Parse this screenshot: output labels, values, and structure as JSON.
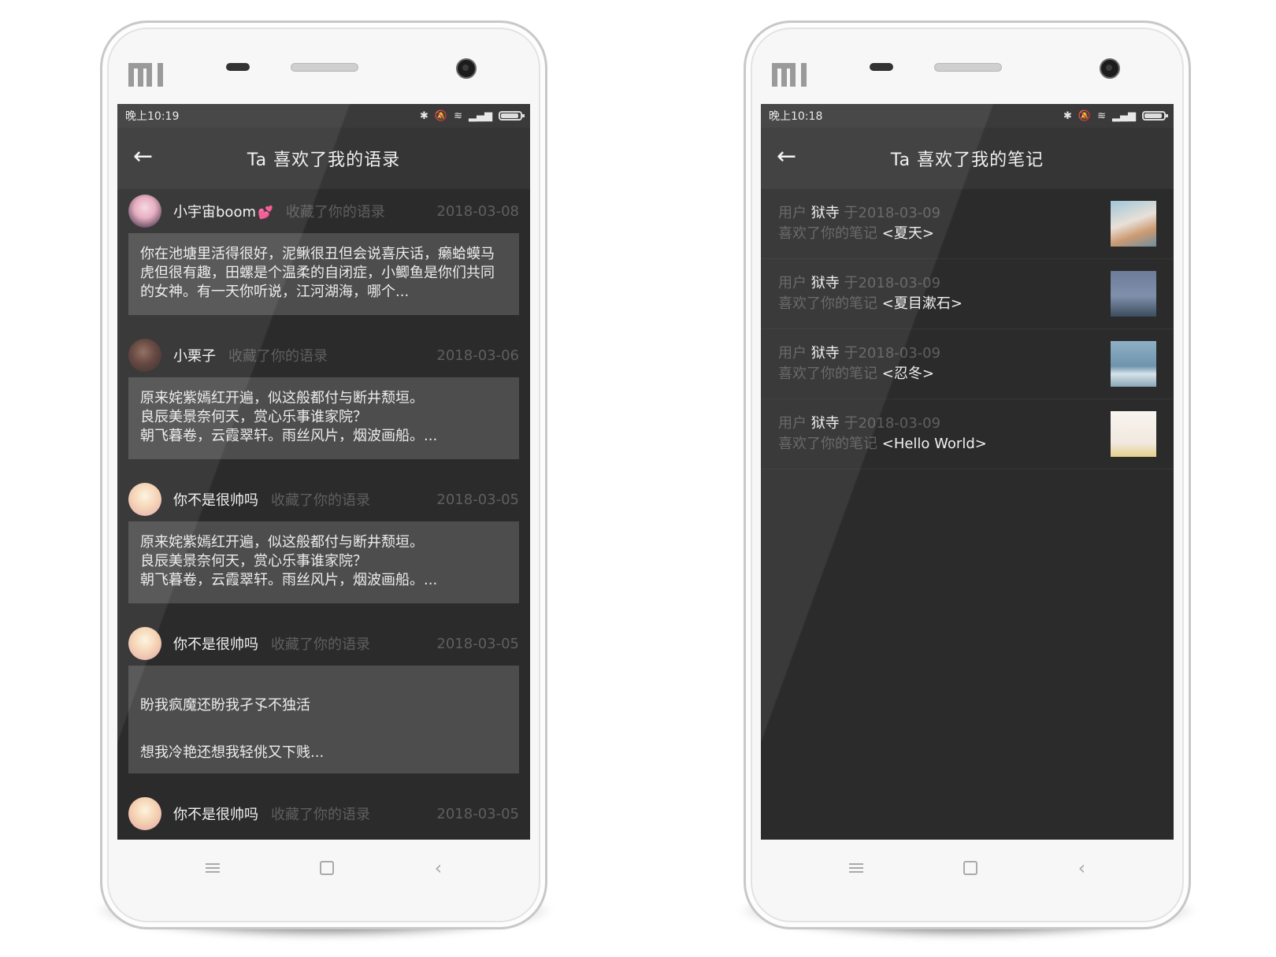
{
  "left_phone": {
    "brand": "mi",
    "status_time": "晚上10:19",
    "status_icons": [
      "bluetooth-icon",
      "mute-icon",
      "wifi-icon",
      "signal-icon",
      "battery-icon"
    ],
    "title": "Ta 喜欢了我的语录",
    "entries": [
      {
        "user": "小宇宙boom",
        "user_suffix": "💕",
        "action": "收藏了你的语录",
        "date": "2018-03-08",
        "quote": "你在池塘里活得很好，泥鳅很丑但会说喜庆话，癞蛤蟆马虎但很有趣，田螺是个温柔的自闭症，小鲫鱼是你们共同的女神。有一天你听说，江河湖海，哪个..."
      },
      {
        "user": "小栗子",
        "user_suffix": "",
        "action": "收藏了你的语录",
        "date": "2018-03-06",
        "quote": "原来姹紫嫣红开遍，似这般都付与断井颓垣。\n良辰美景奈何天，赏心乐事谁家院？\n朝飞暮卷，云霞翠轩。雨丝风片，烟波画船。..."
      },
      {
        "user": "你不是很帅吗",
        "user_suffix": "",
        "action": "收藏了你的语录",
        "date": "2018-03-05",
        "quote": "原来姹紫嫣红开遍，似这般都付与断井颓垣。\n良辰美景奈何天，赏心乐事谁家院？\n朝飞暮卷，云霞翠轩。雨丝风片，烟波画船。..."
      },
      {
        "user": "你不是很帅吗",
        "user_suffix": "",
        "action": "收藏了你的语录",
        "date": "2018-03-05",
        "quote_line1": "盼我疯魔还盼我孑孓不独活",
        "quote_line2": "想我冷艳还想我轻佻又下贱..."
      },
      {
        "user": "你不是很帅吗",
        "user_suffix": "",
        "action": "收藏了你的语录",
        "date": "2018-03-05"
      }
    ]
  },
  "right_phone": {
    "brand": "mi",
    "status_time": "晚上10:18",
    "status_icons": [
      "bluetooth-icon",
      "mute-icon",
      "wifi-icon",
      "signal-icon",
      "battery-icon"
    ],
    "title": "Ta 喜欢了我的笔记",
    "notes": [
      {
        "prefix": "用户",
        "user": "狱寺",
        "date_text": "于2018-03-09",
        "action": "喜欢了你的笔记",
        "note": "<夏天>"
      },
      {
        "prefix": "用户",
        "user": "狱寺",
        "date_text": "于2018-03-09",
        "action": "喜欢了你的笔记",
        "note": "<夏目漱石>"
      },
      {
        "prefix": "用户",
        "user": "狱寺",
        "date_text": "于2018-03-09",
        "action": "喜欢了你的笔记",
        "note": "<忍冬>"
      },
      {
        "prefix": "用户",
        "user": "狱寺",
        "date_text": "于2018-03-09",
        "action": "喜欢了你的笔记",
        "note": "<Hello World>"
      }
    ]
  }
}
